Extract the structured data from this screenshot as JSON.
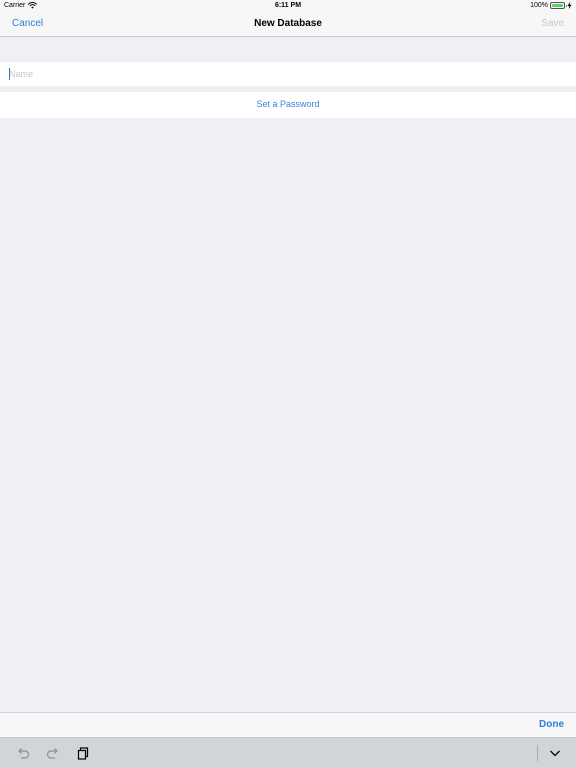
{
  "status_bar": {
    "carrier": "Carrier",
    "time": "6:11 PM",
    "battery": "100%",
    "icons": [
      "wifi-icon",
      "battery-icon",
      "charging-icon"
    ]
  },
  "nav_bar": {
    "cancel_label": "Cancel",
    "title": "New Database",
    "save_label": "Save"
  },
  "form": {
    "name_value": "",
    "name_placeholder": "Name",
    "password_label": "Set a Password"
  },
  "keyboard_accessory": {
    "done_label": "Done"
  },
  "shortcut_bar": {
    "icons": [
      "undo-icon",
      "redo-icon",
      "paste-icon",
      "dismiss-keyboard-icon"
    ]
  },
  "colors": {
    "accent": "#2f7bd8",
    "disabled": "#c7c7cc",
    "background": "#efeff4",
    "battery": "#4cd964"
  }
}
